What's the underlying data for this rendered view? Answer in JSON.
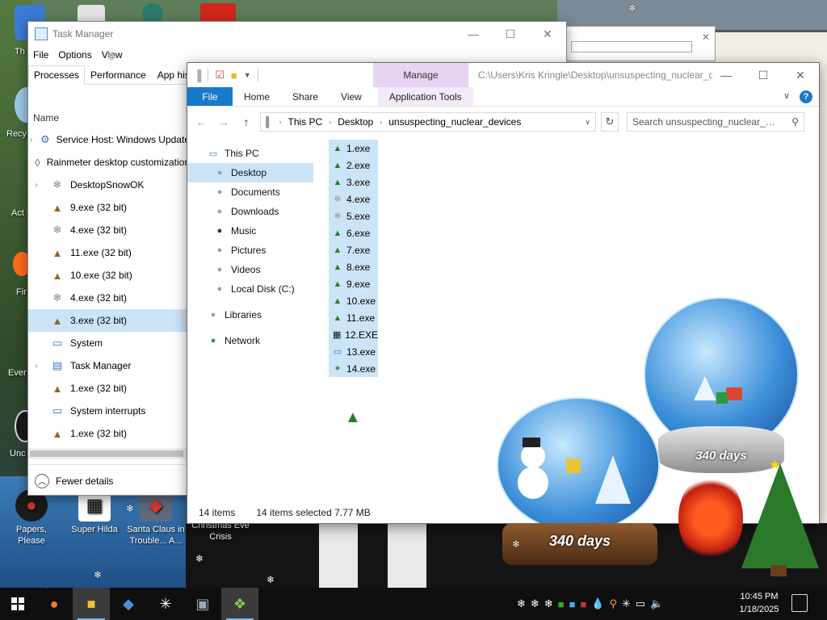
{
  "desktop": {
    "icons": [
      {
        "label": "Papers, Please"
      },
      {
        "label": "Super Hilda"
      },
      {
        "label": "Santa Claus in Trouble... A..."
      },
      {
        "label": "Christmas Eve Crisis"
      }
    ],
    "cut_labels": [
      "Th",
      "Recy",
      "Act",
      "Fir",
      "Ever",
      "Unc"
    ]
  },
  "task_manager": {
    "title": "Task Manager",
    "menu": [
      "File",
      "Options",
      "View"
    ],
    "tabs": [
      "Processes",
      "Performance",
      "App history"
    ],
    "column_name": "Name",
    "processes": [
      {
        "name": "Service Host: Windows Update",
        "expandable": true,
        "icon": "gear-icon"
      },
      {
        "name": "Rainmeter desktop customization",
        "expandable": false,
        "icon": "droplet-icon"
      },
      {
        "name": "DesktopSnowOK",
        "expandable": true,
        "icon": "snowflake-icon"
      },
      {
        "name": "9.exe (32 bit)",
        "expandable": false,
        "icon": "tree-icon"
      },
      {
        "name": "4.exe (32 bit)",
        "expandable": false,
        "icon": "snowflake-icon"
      },
      {
        "name": "11.exe (32 bit)",
        "expandable": false,
        "icon": "tree-icon"
      },
      {
        "name": "10.exe (32 bit)",
        "expandable": false,
        "icon": "tree-icon"
      },
      {
        "name": "4.exe (32 bit)",
        "expandable": false,
        "icon": "snowflake-icon"
      },
      {
        "name": "3.exe (32 bit)",
        "expandable": false,
        "icon": "tree-icon",
        "selected": true
      },
      {
        "name": "System",
        "expandable": false,
        "icon": "window-icon"
      },
      {
        "name": "Task Manager",
        "expandable": true,
        "icon": "task-manager-icon"
      },
      {
        "name": "1.exe (32 bit)",
        "expandable": false,
        "icon": "tree-icon"
      },
      {
        "name": "System interrupts",
        "expandable": false,
        "icon": "window-icon"
      },
      {
        "name": "1.exe (32 bit)",
        "expandable": false,
        "icon": "tree-icon"
      }
    ],
    "fewer_details": "Fewer details"
  },
  "explorer": {
    "manage_label": "Manage",
    "title_path": "C:\\Users\\Kris Kringle\\Desktop\\unsuspecting_nuclear_devices",
    "ribbon_tabs": [
      "File",
      "Home",
      "Share",
      "View",
      "Application Tools"
    ],
    "breadcrumb": [
      "This PC",
      "Desktop",
      "unsuspecting_nuclear_devices"
    ],
    "search_placeholder": "Search unsuspecting_nuclear_devices",
    "nav": [
      {
        "label": "This PC",
        "level": 0,
        "icon": "computer-icon"
      },
      {
        "label": "Desktop",
        "level": 1,
        "icon": "desktop-folder-icon",
        "selected": true
      },
      {
        "label": "Documents",
        "level": 1,
        "icon": "documents-icon"
      },
      {
        "label": "Downloads",
        "level": 1,
        "icon": "downloads-icon"
      },
      {
        "label": "Music",
        "level": 1,
        "icon": "music-icon"
      },
      {
        "label": "Pictures",
        "level": 1,
        "icon": "pictures-icon"
      },
      {
        "label": "Videos",
        "level": 1,
        "icon": "videos-icon"
      },
      {
        "label": "Local Disk (C:)",
        "level": 1,
        "icon": "drive-icon"
      },
      {
        "label": "Libraries",
        "level": 0,
        "icon": "libraries-icon",
        "gap": true
      },
      {
        "label": "Network",
        "level": 0,
        "icon": "network-icon",
        "gap": true
      }
    ],
    "files": [
      {
        "name": "1.exe",
        "icon": "tree-icon"
      },
      {
        "name": "2.exe",
        "icon": "tree-icon"
      },
      {
        "name": "3.exe",
        "icon": "tree-icon"
      },
      {
        "name": "4.exe",
        "icon": "snowflake-icon"
      },
      {
        "name": "5.exe",
        "icon": "snowflake-icon"
      },
      {
        "name": "6.exe",
        "icon": "tree-icon"
      },
      {
        "name": "7.exe",
        "icon": "tree-icon"
      },
      {
        "name": "8.exe",
        "icon": "tree-icon"
      },
      {
        "name": "9.exe",
        "icon": "tree-icon"
      },
      {
        "name": "10.exe",
        "icon": "tree-icon"
      },
      {
        "name": "11.exe",
        "icon": "tree-icon"
      },
      {
        "name": "12.EXE",
        "icon": "console-icon"
      },
      {
        "name": "13.exe",
        "icon": "window-icon"
      },
      {
        "name": "14.exe",
        "icon": "santa-icon"
      }
    ],
    "status_count": "14 items",
    "status_selected": "14 items selected  7.77 MB"
  },
  "decorations": {
    "globe_days_large": "340 days",
    "globe_days_small": "340 days"
  },
  "taskbar": {
    "time": "10:45 PM",
    "date": "1/18/2025"
  },
  "colors": {
    "selection": "#cce4f7",
    "ribbon_file": "#1979ca",
    "manage_tab": "#e8d3f2"
  }
}
